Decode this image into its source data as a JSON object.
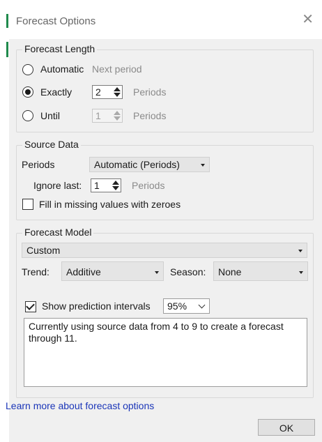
{
  "dialog": {
    "title": "Forecast Options",
    "close_glyph": "✕"
  },
  "forecast_length": {
    "title": "Forecast Length",
    "automatic": {
      "label": "Automatic",
      "hint": "Next period",
      "checked": false
    },
    "exactly": {
      "label": "Exactly",
      "value": "2",
      "unit": "Periods",
      "checked": true
    },
    "until": {
      "label": "Until",
      "value": "1",
      "unit": "Periods",
      "checked": false,
      "disabled": true
    }
  },
  "source_data": {
    "title": "Source Data",
    "periods_label": "Periods",
    "periods_value": "Automatic (Periods)",
    "ignore_last_label": "Ignore last:",
    "ignore_last_value": "1",
    "ignore_last_unit": "Periods",
    "fill_missing_label": "Fill in missing values with zeroes",
    "fill_missing_checked": false
  },
  "forecast_model": {
    "title": "Forecast Model",
    "model_value": "Custom",
    "trend_label": "Trend:",
    "trend_value": "Additive",
    "season_label": "Season:",
    "season_value": "None",
    "show_intervals_label": "Show prediction intervals",
    "show_intervals_checked": true,
    "interval_value": "95%",
    "description": "Currently using source data from 4 to 9 to create a forecast through 11."
  },
  "footer": {
    "learn_more": "Learn more about forecast options",
    "ok_label": "OK"
  },
  "colors": {
    "accent": "#1f8a4c",
    "link": "#1a35b8",
    "panel_bg": "#f0f0f0"
  }
}
